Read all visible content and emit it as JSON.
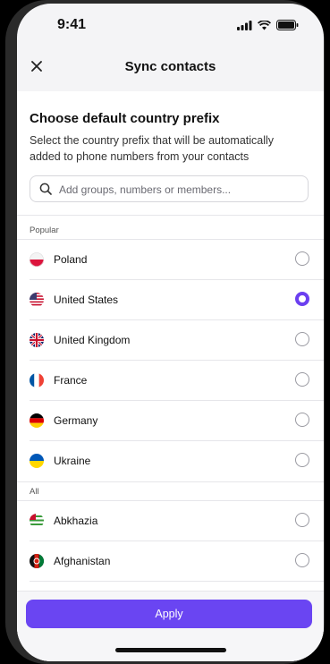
{
  "status_bar": {
    "time": "9:41"
  },
  "navbar": {
    "title": "Sync contacts",
    "close_icon": "close-icon"
  },
  "intro": {
    "heading": "Choose default country prefix",
    "description": "Select the country prefix that will be automatically added to phone numbers from your contacts"
  },
  "search": {
    "placeholder": "Add groups, numbers or members...",
    "value": ""
  },
  "sections": {
    "popular_label": "Popular",
    "all_label": "All"
  },
  "popular": [
    {
      "name": "Poland",
      "selected": false
    },
    {
      "name": "United States",
      "selected": true
    },
    {
      "name": "United Kingdom",
      "selected": false
    },
    {
      "name": "France",
      "selected": false
    },
    {
      "name": "Germany",
      "selected": false
    },
    {
      "name": "Ukraine",
      "selected": false
    }
  ],
  "all": [
    {
      "name": "Abkhazia",
      "selected": false
    },
    {
      "name": "Afghanistan",
      "selected": false
    }
  ],
  "footer": {
    "apply_label": "Apply"
  },
  "colors": {
    "accent": "#6a45f2",
    "radio_selected": "#6b3ff0"
  }
}
